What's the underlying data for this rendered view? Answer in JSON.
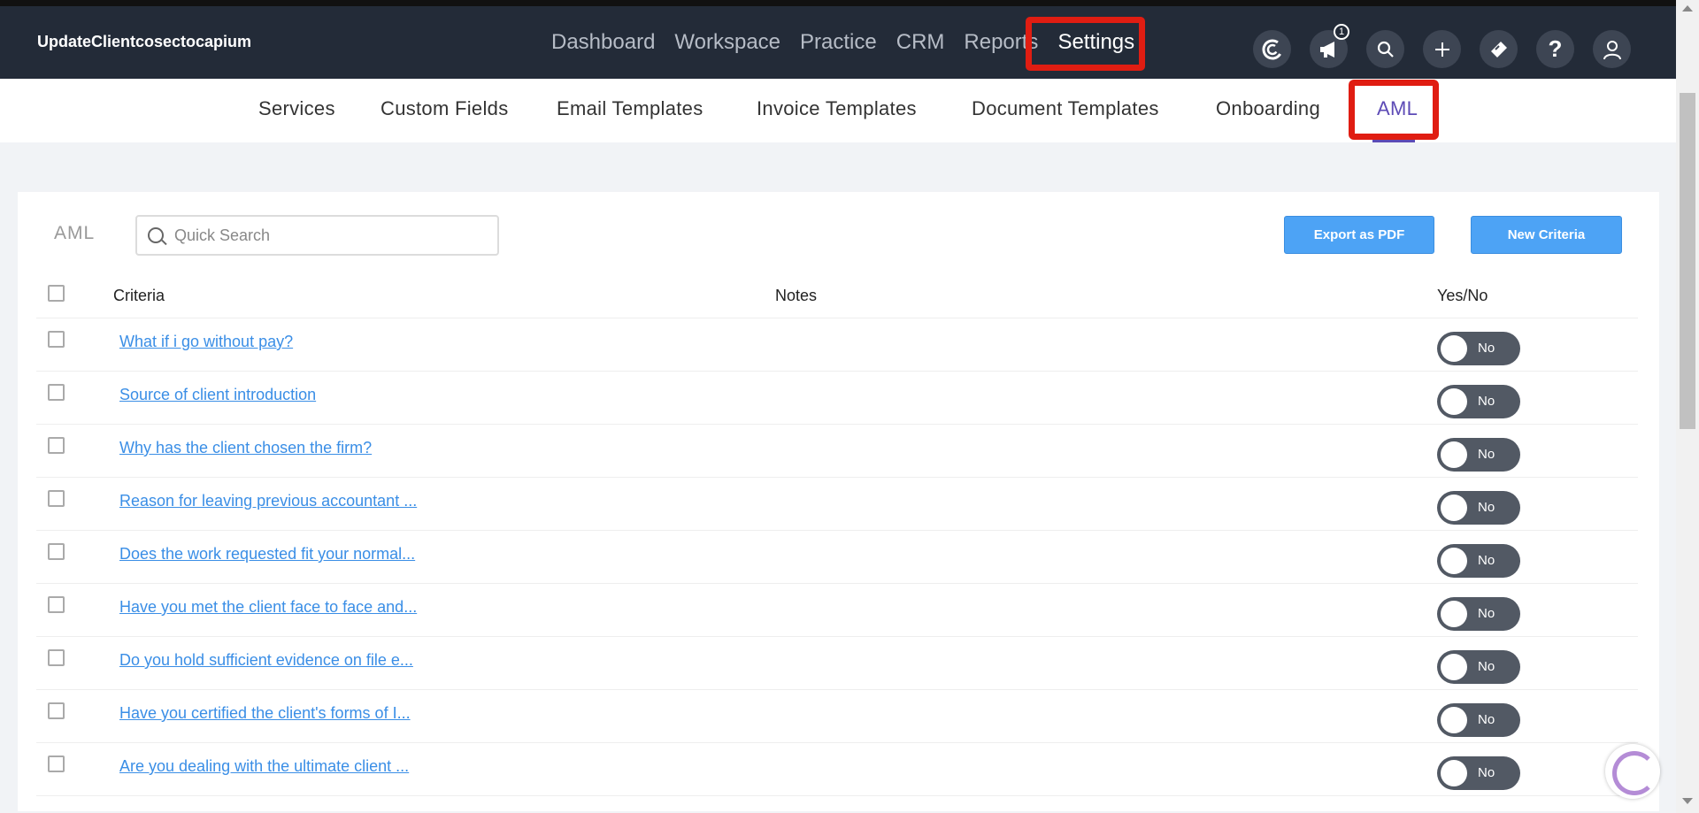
{
  "header": {
    "brand": "UpdateClientcosectocapium",
    "nav": [
      "Dashboard",
      "Workspace",
      "Practice",
      "CRM",
      "Reports",
      "Settings"
    ],
    "active_nav": "Settings",
    "notification_count": "1",
    "icons": [
      "capium-logo-icon",
      "megaphone-icon",
      "search-icon",
      "plus-icon",
      "ticket-icon",
      "help-icon",
      "user-icon"
    ]
  },
  "subnav": {
    "tabs": [
      "Services",
      "Custom Fields",
      "Email Templates",
      "Invoice Templates",
      "Document Templates",
      "Onboarding",
      "AML"
    ],
    "active_tab": "AML"
  },
  "page": {
    "title": "AML",
    "search_placeholder": "Quick Search",
    "export_label": "Export as PDF",
    "new_label": "New Criteria"
  },
  "table": {
    "columns": [
      "Criteria",
      "Notes",
      "Yes/No"
    ],
    "rows": [
      {
        "criteria": "What if i go without pay?",
        "notes": "",
        "toggle": "No"
      },
      {
        "criteria": "Source of client introduction",
        "notes": "",
        "toggle": "No"
      },
      {
        "criteria": "Why has the client chosen the firm?",
        "notes": "",
        "toggle": "No"
      },
      {
        "criteria": "Reason for leaving previous accountant ...",
        "notes": "",
        "toggle": "No"
      },
      {
        "criteria": "Does the work requested fit your normal...",
        "notes": "",
        "toggle": "No"
      },
      {
        "criteria": "Have you met the client face to face and...",
        "notes": "",
        "toggle": "No"
      },
      {
        "criteria": "Do you hold sufficient evidence on file e...",
        "notes": "",
        "toggle": "No"
      },
      {
        "criteria": "Have you certified the client's forms of I...",
        "notes": "",
        "toggle": "No"
      },
      {
        "criteria": "Are you dealing with the ultimate client ...",
        "notes": "",
        "toggle": "No"
      }
    ]
  },
  "colors": {
    "topbar": "#232b38",
    "accent": "#5d4bb6",
    "button": "#4da3f5",
    "link": "#3a8ee6",
    "highlight": "#e01d12"
  }
}
